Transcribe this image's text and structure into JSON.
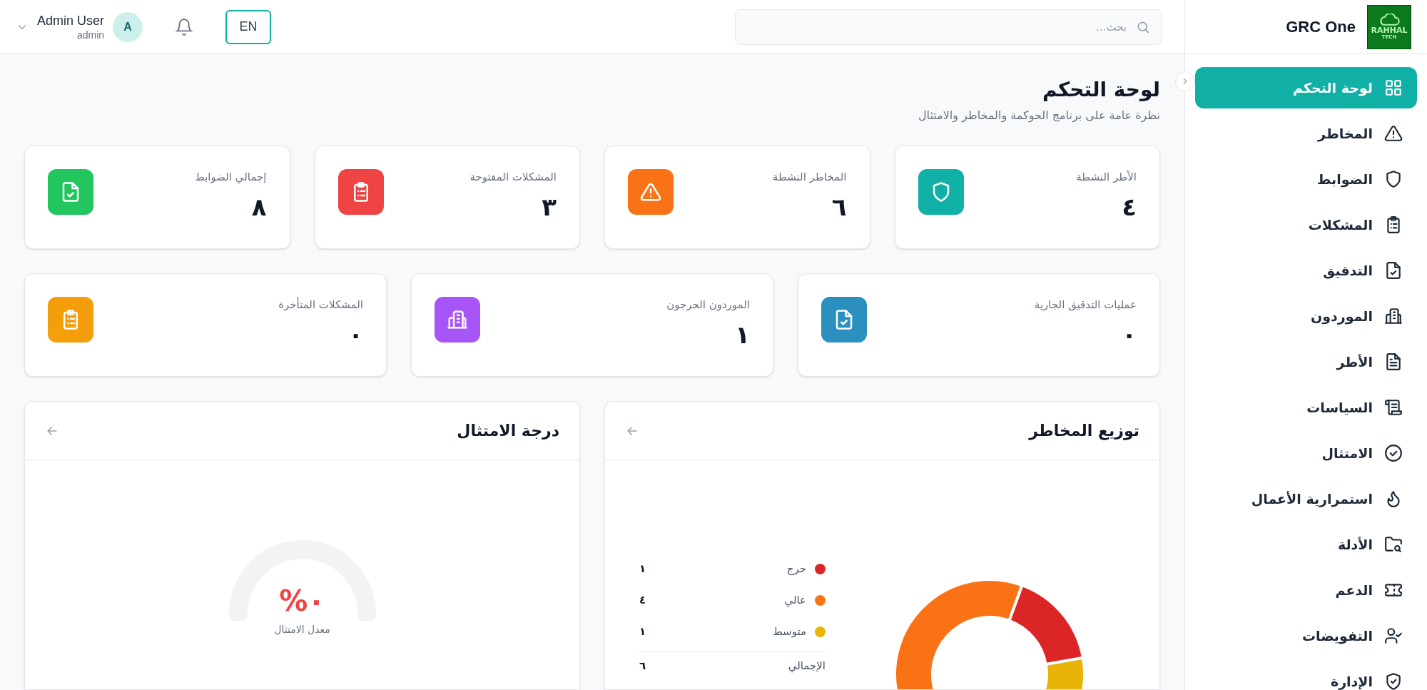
{
  "sidebar": {
    "brand": "GRC One",
    "logo": {
      "line_1": "RAHHAL",
      "line_2": "TECH"
    },
    "items": [
      {
        "label": "لوحة التحكم",
        "selected": true
      },
      {
        "label": "المخاطر",
        "selected": false
      },
      {
        "label": "الضوابط",
        "selected": false
      },
      {
        "label": "المشكلات",
        "selected": false
      },
      {
        "label": "التدقيق",
        "selected": false
      },
      {
        "label": "الموردون",
        "selected": false
      },
      {
        "label": "الأطر",
        "selected": false
      },
      {
        "label": "السياسات",
        "selected": false
      },
      {
        "label": "الامتثال",
        "selected": false
      },
      {
        "label": "استمرارية الأعمال",
        "selected": false
      },
      {
        "label": "الأدلة",
        "selected": false
      },
      {
        "label": "الدعم",
        "selected": false
      },
      {
        "label": "التفويضات",
        "selected": false
      },
      {
        "label": "الإدارة",
        "selected": false
      }
    ]
  },
  "topbar": {
    "search": {
      "placeholder": "بحث..."
    },
    "language": "EN",
    "user": {
      "name": "Admin User",
      "role": "admin",
      "initial": "A"
    }
  },
  "page": {
    "title": "لوحة التحكم",
    "subtitle": "نظرة عامة على برنامج الحوكمة والمخاطر والامتثال"
  },
  "stats_row_1": [
    {
      "label": "الأطر النشطة",
      "value": "٤",
      "color": "#10b0a6"
    },
    {
      "label": "المخاطر النشطة",
      "value": "٦",
      "color": "#f97316"
    },
    {
      "label": "المشكلات المفتوحة",
      "value": "٣",
      "color": "#ef4444"
    },
    {
      "label": "إجمالي الضوابط",
      "value": "٨",
      "color": "#22c55e"
    }
  ],
  "stats_row_2": [
    {
      "label": "عمليات التدقيق الجارية",
      "value": "٠",
      "color": "#2b8fc0"
    },
    {
      "label": "الموردون الحرجون",
      "value": "١",
      "color": "#a855f7"
    },
    {
      "label": "المشكلات المتأخرة",
      "value": "٠",
      "color": "#f59e0b"
    }
  ],
  "risk_distribution": {
    "title": "توزيع المخاطر",
    "legend": [
      {
        "count": "١",
        "color": "#dc2626"
      },
      {
        "count": "٤",
        "color": "#f97316"
      },
      {
        "count": "١",
        "color": "#eab308"
      }
    ],
    "total": {
      "label": "الإجمالي",
      "count": "٦"
    },
    "chart_data": {
      "type": "donut",
      "categories": [
        "حرج",
        "عالي",
        "متوسط"
      ],
      "values": [
        16.67,
        66.66,
        16.67
      ]
    }
  },
  "compliance_score": {
    "title": "درجة الامتثال",
    "value_text": "٠%",
    "caption": "معدل الامتثال"
  }
}
